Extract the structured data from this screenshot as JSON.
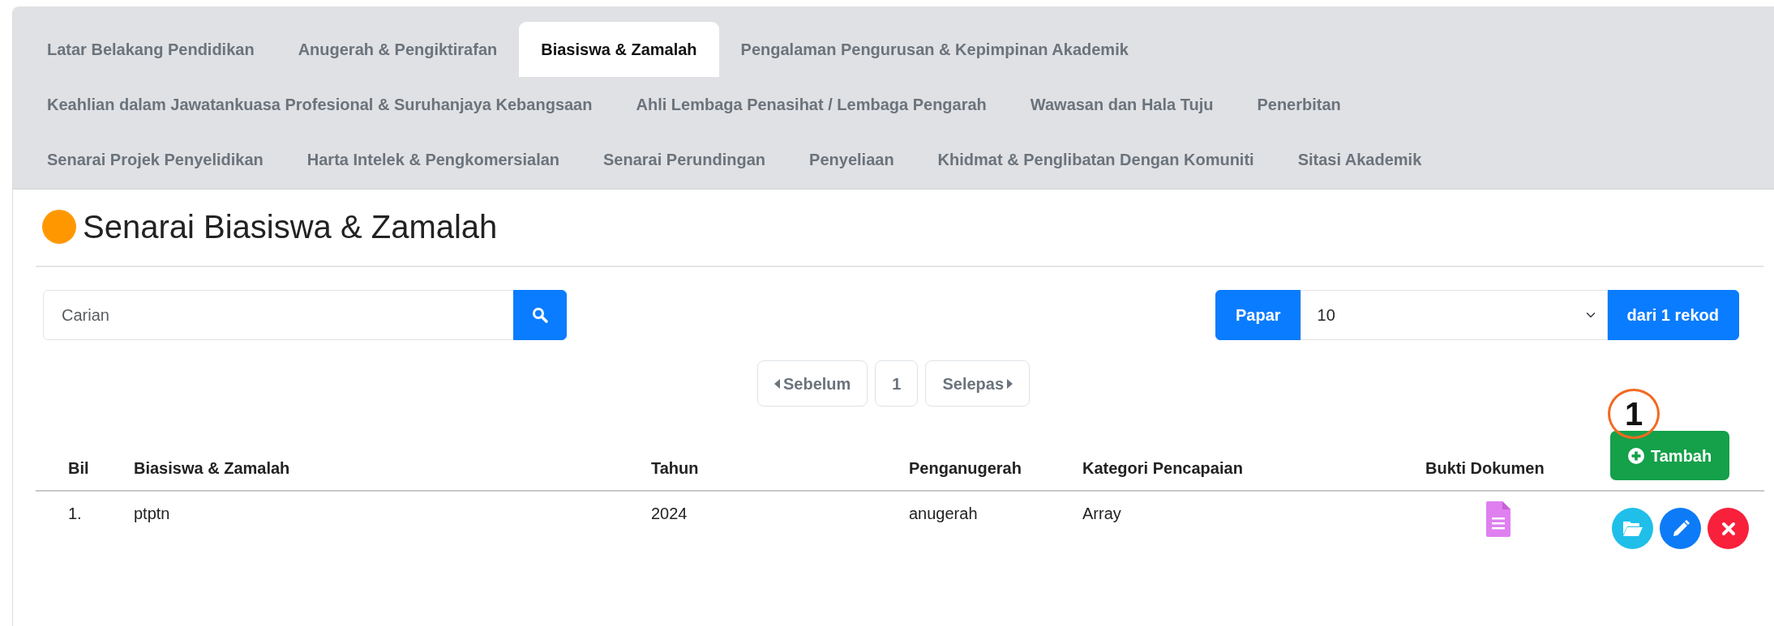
{
  "tab_rows": [
    {
      "tabs": [
        {
          "label": "Latar Belakang Pendidikan",
          "selected": false
        },
        {
          "label": "Anugerah & Pengiktirafan",
          "selected": false
        },
        {
          "label": "Biasiswa & Zamalah",
          "selected": true
        },
        {
          "label": "Pengalaman Pengurusan & Kepimpinan Akademik",
          "selected": false
        }
      ]
    },
    {
      "tabs": [
        {
          "label": "Keahlian dalam Jawatankuasa Profesional & Suruhanjaya Kebangsaan",
          "selected": false
        },
        {
          "label": "Ahli Lembaga Penasihat / Lembaga Pengarah",
          "selected": false
        },
        {
          "label": "Wawasan dan Hala Tuju",
          "selected": false
        },
        {
          "label": "Penerbitan",
          "selected": false
        }
      ]
    },
    {
      "tabs": [
        {
          "label": "Senarai Projek Penyelidikan",
          "selected": false
        },
        {
          "label": "Harta Intelek & Pengkomersialan",
          "selected": false
        },
        {
          "label": "Senarai Perundingan",
          "selected": false
        },
        {
          "label": "Penyeliaan",
          "selected": false
        },
        {
          "label": "Khidmat & Penglibatan Dengan Komuniti",
          "selected": false
        },
        {
          "label": "Sitasi Akademik",
          "selected": false
        }
      ]
    }
  ],
  "heading": {
    "title": "Senarai Biasiswa & Zamalah",
    "color": "#ff9800"
  },
  "search": {
    "placeholder": "Carian"
  },
  "page_size": {
    "prefix": "Papar",
    "value": "10",
    "suffix": "dari 1 rekod"
  },
  "pagination": {
    "previous": "Sebelum",
    "pages": [
      {
        "label": "1",
        "selected": false
      }
    ],
    "next": "Selepas"
  },
  "table": {
    "columns": [
      "Bil",
      "Biasiswa & Zamalah",
      "Tahun",
      "Penganugerah",
      "Kategori Pencapaian",
      "Bukti Dokumen"
    ],
    "add_button": "Tambah",
    "annotation": "1",
    "rows": [
      {
        "cells": [
          "1.",
          "ptptn",
          "2024",
          "anugerah",
          "Array"
        ],
        "has_document": true
      }
    ]
  }
}
